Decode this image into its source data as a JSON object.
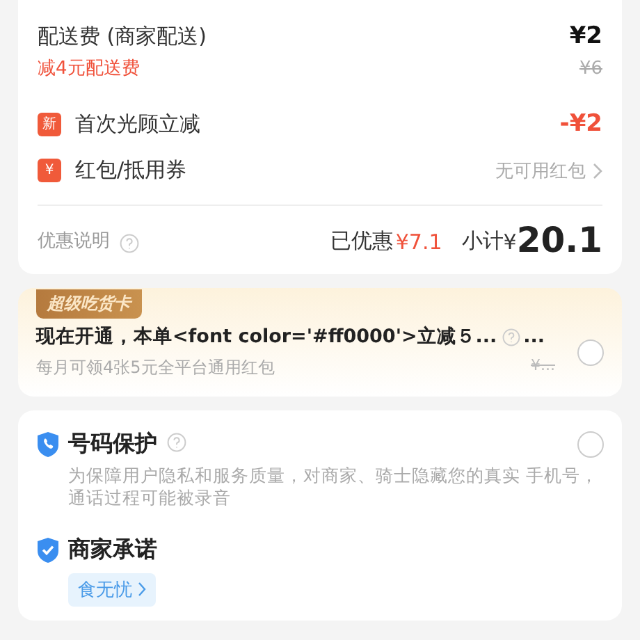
{
  "fees": [
    {
      "label": "配送费 (商家配送)",
      "amount": "¥2",
      "note": "减4元配送费",
      "original": "¥6"
    }
  ],
  "discounts": [
    {
      "kind": "amount",
      "badge": "新",
      "label": "首次光顾立减",
      "value": "-¥2"
    },
    {
      "kind": "link",
      "badge": "¥",
      "label": "红包/抵用券",
      "value": "无可用红包"
    }
  ],
  "summary": {
    "info": "优惠说明",
    "saved_label": "已优惠",
    "saved": "¥7.1",
    "subtotal_label": "小计",
    "currency": "¥",
    "subtotal": "20.1"
  },
  "super_card": {
    "tag": "超级吃货卡",
    "title": "现在开通，本单<font color='#ff0000'>立减５...",
    "title_tail": "...",
    "subtitle": "每月可领4张5元全平台通用红包",
    "price": "¥...",
    "selected": false
  },
  "services": [
    {
      "kind": "option",
      "title": "号码保护",
      "selected": false,
      "desc": "为保障用户隐私和服务质量，对商家、骑士隐藏您的真实 手机号，通话过程可能被录音"
    },
    {
      "kind": "promise",
      "title": "商家承诺",
      "tags": [
        "食无忧"
      ]
    }
  ]
}
